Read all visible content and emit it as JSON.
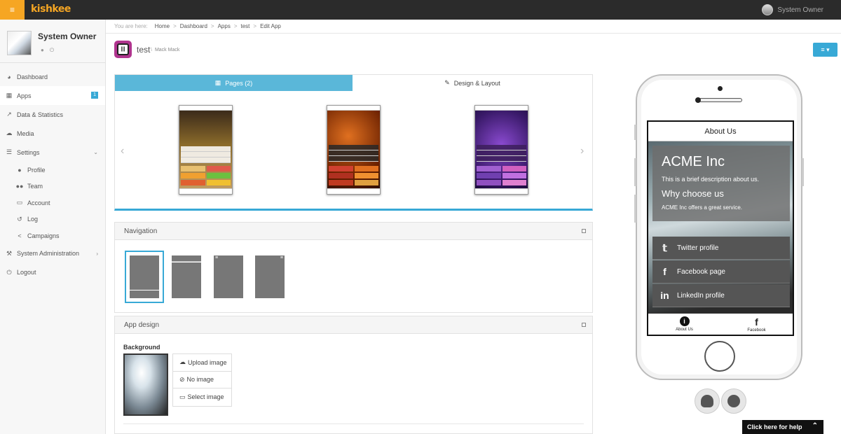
{
  "topbar": {
    "logo": "kishkee",
    "menu_icon": "menu-icon",
    "user_name": "System Owner"
  },
  "sidebar": {
    "profile_name": "System Owner",
    "items": [
      {
        "label": "Dashboard",
        "icon": "dashboard-icon"
      },
      {
        "label": "Apps",
        "icon": "grid-icon",
        "badge": "1"
      },
      {
        "label": "Data & Statistics",
        "icon": "chart-icon"
      },
      {
        "label": "Media",
        "icon": "cloud-icon"
      },
      {
        "label": "Settings",
        "icon": "settings-icon"
      },
      {
        "label": "Profile",
        "icon": "user-icon"
      },
      {
        "label": "Team",
        "icon": "team-icon"
      },
      {
        "label": "Account",
        "icon": "card-icon"
      },
      {
        "label": "Log",
        "icon": "history-icon"
      },
      {
        "label": "Campaigns",
        "icon": "share-icon"
      },
      {
        "label": "System Administration",
        "icon": "wrench-icon"
      },
      {
        "label": "Logout",
        "icon": "power-icon"
      }
    ]
  },
  "breadcrumb": {
    "prefix": "You are here:",
    "items": [
      "Home",
      "Dashboard",
      "Apps",
      "test",
      "Edit App"
    ]
  },
  "header": {
    "title": "test",
    "subtitle": "Mack Mack"
  },
  "tabs": {
    "pages": "Pages (2)",
    "design": "Design & Layout"
  },
  "thumbnails": [
    {
      "name": "About Us page thumbnail",
      "colors": [
        "#3b2a1a",
        "#8a6a2a"
      ]
    },
    {
      "name": "Facebook page thumbnail",
      "colors": [
        "#1a0a00",
        "#a8401a"
      ]
    },
    {
      "name": "Gallery page thumbnail",
      "colors": [
        "#1a0a3a",
        "#5a2a8a"
      ]
    }
  ],
  "navigation": {
    "title": "Navigation"
  },
  "app_design": {
    "title": "App design",
    "background_label": "Background",
    "upload": "Upload image",
    "no_image": "No image",
    "select": "Select image"
  },
  "phone": {
    "screen_title": "About Us",
    "hero_title": "ACME Inc",
    "hero_text1": "This is a brief description about us.",
    "hero_subtitle": "Why choose us",
    "hero_text2": "ACME Inc offers a great service.",
    "links": [
      {
        "label": "Twitter profile",
        "icon": "twitter-icon"
      },
      {
        "label": "Facebook page",
        "icon": "facebook-icon"
      },
      {
        "label": "LinkedIn profile",
        "icon": "linkedin-icon"
      }
    ],
    "tabbar": [
      {
        "label": "About Us",
        "icon": "info-icon"
      },
      {
        "label": "Facebook",
        "icon": "facebook-icon"
      }
    ]
  },
  "help": {
    "label": "Click here for help"
  },
  "colors": {
    "accent": "#38a9d6",
    "brand": "#f6a623",
    "topbar": "#2b2b2b"
  }
}
